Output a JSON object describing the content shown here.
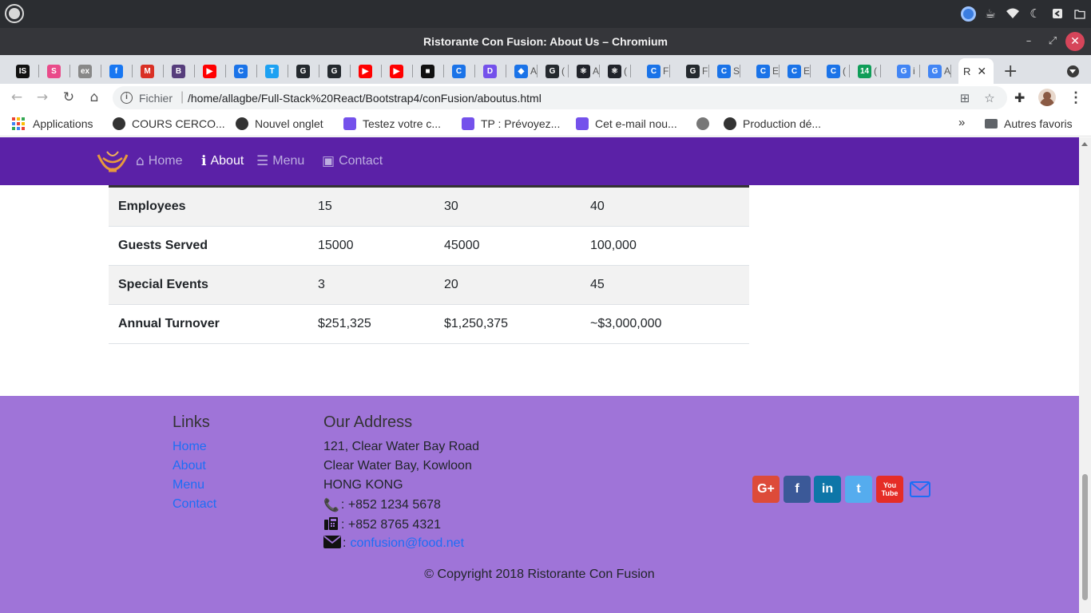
{
  "window": {
    "title": "Ristorante Con Fusion: About Us – Chromium"
  },
  "tabs": [
    {
      "label": "",
      "icon": "jetbrains-icon",
      "color": "#111111",
      "glyph": "IS"
    },
    {
      "label": "",
      "icon": "swirl-icon",
      "color": "#e94b8a",
      "glyph": "S"
    },
    {
      "label": "",
      "icon": "ex-icon",
      "color": "#888888",
      "glyph": "ex"
    },
    {
      "label": "",
      "icon": "facebook-icon",
      "color": "#1877f2",
      "glyph": "f"
    },
    {
      "label": "",
      "icon": "gmail-icon",
      "color": "#d93025",
      "glyph": "M"
    },
    {
      "label": "",
      "icon": "bootstrap-icon",
      "color": "#563d7c",
      "glyph": "B"
    },
    {
      "label": "",
      "icon": "youtube-icon",
      "color": "#ff0000",
      "glyph": "▶"
    },
    {
      "label": "",
      "icon": "c-icon",
      "color": "#1a73e8",
      "glyph": "C"
    },
    {
      "label": "",
      "icon": "twitter-icon",
      "color": "#1da1f2",
      "glyph": "T"
    },
    {
      "label": "",
      "icon": "github-icon",
      "color": "#24292e",
      "glyph": "G"
    },
    {
      "label": "",
      "icon": "github-icon",
      "color": "#24292e",
      "glyph": "G"
    },
    {
      "label": "",
      "icon": "youtube-icon",
      "color": "#ff0000",
      "glyph": "▶"
    },
    {
      "label": "",
      "icon": "youtube-icon",
      "color": "#ff0000",
      "glyph": "▶"
    },
    {
      "label": "",
      "icon": "video-icon",
      "color": "#111111",
      "glyph": "■"
    },
    {
      "label": "",
      "icon": "c-icon",
      "color": "#1a73e8",
      "glyph": "C"
    },
    {
      "label": "",
      "icon": "openclassrooms-icon",
      "color": "#7451eb",
      "glyph": "D"
    },
    {
      "label": "A",
      "icon": "shield-icon",
      "color": "#1a73e8",
      "glyph": "◆"
    },
    {
      "label": "(",
      "icon": "github-icon",
      "color": "#24292e",
      "glyph": "G"
    },
    {
      "label": "A",
      "icon": "react-icon",
      "color": "#20232a",
      "glyph": "⚛"
    },
    {
      "label": "(",
      "icon": "react-icon",
      "color": "#20232a",
      "glyph": "⚛"
    },
    {
      "label": "F",
      "icon": "c-icon",
      "color": "#1a73e8",
      "glyph": "C"
    },
    {
      "label": "F",
      "icon": "github-icon",
      "color": "#24292e",
      "glyph": "G"
    },
    {
      "label": "S",
      "icon": "c-icon",
      "color": "#1a73e8",
      "glyph": "C"
    },
    {
      "label": "E",
      "icon": "c-icon",
      "color": "#1a73e8",
      "glyph": "C"
    },
    {
      "label": "E",
      "icon": "c-icon",
      "color": "#1a73e8",
      "glyph": "C"
    },
    {
      "label": "(",
      "icon": "c-icon",
      "color": "#1a73e8",
      "glyph": "C"
    },
    {
      "label": "(",
      "icon": "badge-14-icon",
      "color": "#0f9d58",
      "glyph": "14"
    },
    {
      "label": "i",
      "icon": "google-icon",
      "color": "#4285f4",
      "glyph": "G"
    },
    {
      "label": "A",
      "icon": "google-icon",
      "color": "#4285f4",
      "glyph": "G"
    }
  ],
  "active_tab": {
    "label": "R",
    "close": "✕"
  },
  "toolbar": {
    "scheme": "Fichier",
    "separator": "|",
    "url": "/home/allagbe/Full-Stack%20React/Bootstrap4/conFusion/aboutus.html"
  },
  "bookmarks": [
    {
      "label": "Applications",
      "icon": "apps-grid-icon",
      "color": "#4285f4"
    },
    {
      "label": "COURS CERCO...",
      "icon": "globe-icon",
      "color": "#333333"
    },
    {
      "label": "Nouvel onglet",
      "icon": "globe-icon",
      "color": "#333333"
    },
    {
      "label": "Testez votre c...",
      "icon": "openclassrooms-icon",
      "color": "#7451eb"
    },
    {
      "label": "TP : Prévoyez...",
      "icon": "openclassrooms-icon",
      "color": "#7451eb"
    },
    {
      "label": "Cet e-mail nou...",
      "icon": "openclassrooms-icon",
      "color": "#7451eb"
    },
    {
      "label": "",
      "icon": "avatar-icon",
      "color": "#777777"
    },
    {
      "label": "Production dé...",
      "icon": "globe-icon",
      "color": "#333333"
    }
  ],
  "bookmarks_more": "»",
  "other_bookmarks": "Autres favoris",
  "navbar": {
    "items": [
      {
        "label": "Home",
        "icon": "home-icon",
        "glyph": "⌂",
        "active": false
      },
      {
        "label": "About",
        "icon": "info-icon",
        "glyph": "ℹ",
        "active": true
      },
      {
        "label": "Menu",
        "icon": "list-icon",
        "glyph": "☰",
        "active": false
      },
      {
        "label": "Contact",
        "icon": "address-card-icon",
        "glyph": "▣",
        "active": false
      }
    ]
  },
  "facts_table": {
    "rows": [
      [
        "Employees",
        "15",
        "30",
        "40"
      ],
      [
        "Guests Served",
        "15000",
        "45000",
        "100,000"
      ],
      [
        "Special Events",
        "3",
        "20",
        "45"
      ],
      [
        "Annual Turnover",
        "$251,325",
        "$1,250,375",
        "~$3,000,000"
      ]
    ]
  },
  "footer": {
    "links_heading": "Links",
    "links": [
      "Home",
      "About",
      "Menu",
      "Contact"
    ],
    "address_heading": "Our Address",
    "address_lines": [
      "121, Clear Water Bay Road",
      "Clear Water Bay, Kowloon",
      "HONG KONG"
    ],
    "phone": ": +852 1234 5678",
    "fax": ": +852 8765 4321",
    "email_prefix": ":",
    "email": "confusion@food.net",
    "social": [
      {
        "label": "G+",
        "icon": "google-plus-icon",
        "color": "#dd4b39"
      },
      {
        "label": "f",
        "icon": "facebook-icon",
        "color": "#3b5998"
      },
      {
        "label": "in",
        "icon": "linkedin-icon",
        "color": "#0e76a8"
      },
      {
        "label": "t",
        "icon": "twitter-icon",
        "color": "#55acee"
      },
      {
        "label": "You Tube",
        "icon": "youtube-icon",
        "color": "#e52d27"
      }
    ],
    "copyright": "© Copyright 2018 Ristorante Con Fusion"
  },
  "colors": {
    "navbar": "#5b21a7",
    "footer": "#9f74d8",
    "link": "#1d6ef5"
  }
}
